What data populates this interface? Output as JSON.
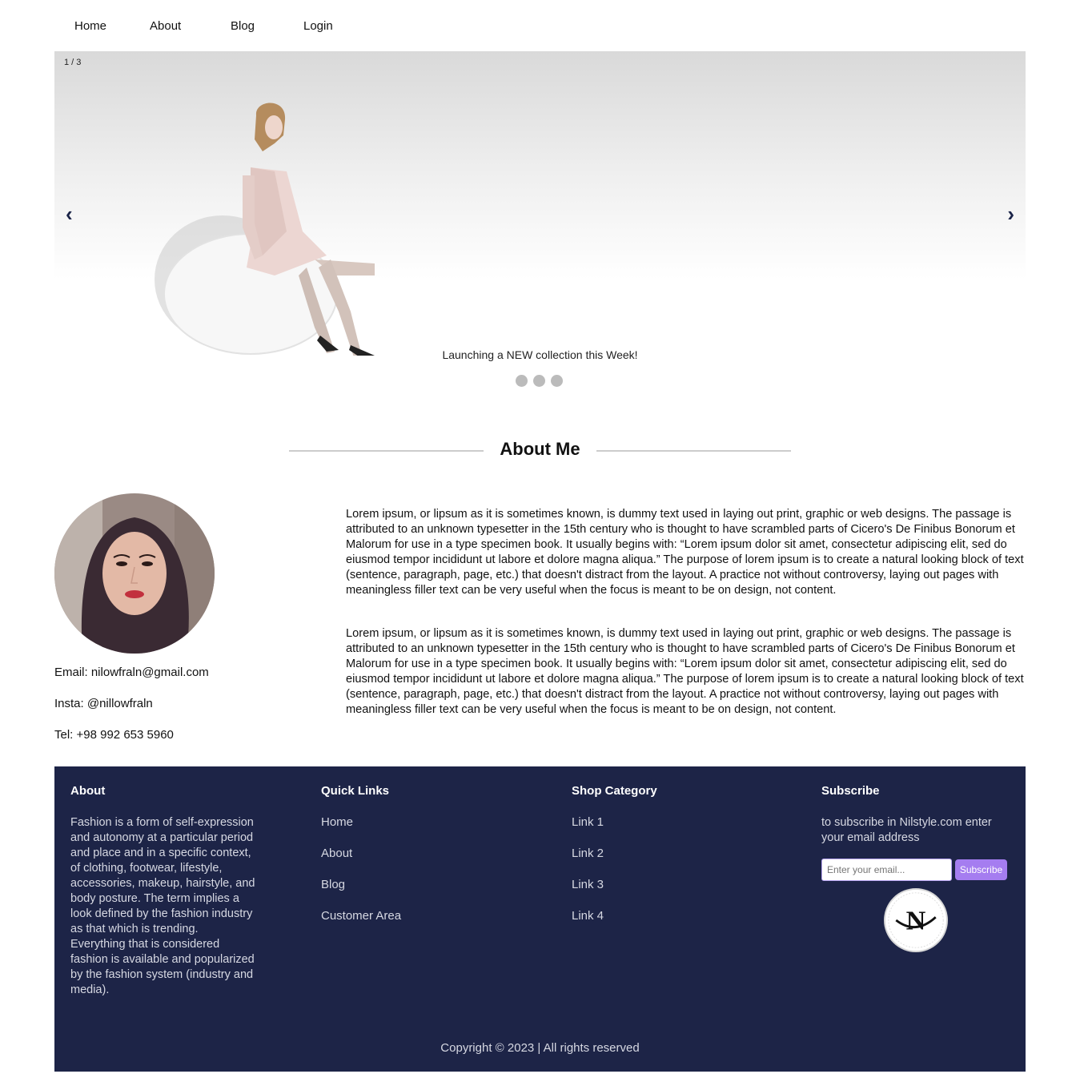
{
  "nav": {
    "items": [
      {
        "label": "Home"
      },
      {
        "label": "About"
      },
      {
        "label": "Blog"
      },
      {
        "label": "Login"
      }
    ]
  },
  "slider": {
    "counter": "1 / 3",
    "prev_icon": "chevron-left-icon",
    "next_icon": "chevron-right-icon",
    "prev_glyph": "‹",
    "next_glyph": "›",
    "caption": "Launching a NEW collection this Week!",
    "active_slide": 1,
    "slide_count": 3
  },
  "about": {
    "heading": "About Me",
    "email": "Email: nilowfraln@gmail.com",
    "insta": "Insta: @nillowfraln",
    "tel": "Tel: +98 992 653 5960",
    "paragraphs": [
      "Lorem ipsum, or lipsum as it is sometimes known, is dummy text used in laying out print, graphic or web designs. The passage is attributed to an unknown typesetter in the 15th century who is thought to have scrambled parts of Cicero's De Finibus Bonorum et Malorum for use in a type specimen book. It usually begins with: “Lorem ipsum dolor sit amet, consectetur adipiscing elit, sed do eiusmod tempor incididunt ut labore et dolore magna aliqua.” The purpose of lorem ipsum is to create a natural looking block of text (sentence, paragraph, page, etc.) that doesn't distract from the layout. A practice not without controversy, laying out pages with meaningless filler text can be very useful when the focus is meant to be on design, not content.",
      "Lorem ipsum, or lipsum as it is sometimes known, is dummy text used in laying out print, graphic or web designs. The passage is attributed to an unknown typesetter in the 15th century who is thought to have scrambled parts of Cicero's De Finibus Bonorum et Malorum for use in a type specimen book. It usually begins with: “Lorem ipsum dolor sit amet, consectetur adipiscing elit, sed do eiusmod tempor incididunt ut labore et dolore magna aliqua.” The purpose of lorem ipsum is to create a natural looking block of text (sentence, paragraph, page, etc.) that doesn't distract from the layout. A practice not without controversy, laying out pages with meaningless filler text can be very useful when the focus is meant to be on design, not content."
    ]
  },
  "footer": {
    "about_title": "About",
    "about_text": "Fashion is a form of self-expression and autonomy at a particular period and place and in a specific context, of clothing, footwear, lifestyle, accessories, makeup, hairstyle, and body posture. The term implies a look defined by the fashion industry as that which is trending. Everything that is considered fashion is available and popularized by the fashion system (industry and media).",
    "quick_title": "Quick Links",
    "quick_links": [
      "Home",
      "About",
      "Blog",
      "Customer Area"
    ],
    "shop_title": "Shop Category",
    "shop_links": [
      "Link 1",
      "Link 2",
      "Link 3",
      "Link 4"
    ],
    "subscribe_title": "Subscribe",
    "subscribe_text": "to subscribe in Nilstyle.com enter your email address",
    "email_placeholder": "Enter your email...",
    "subscribe_button": "Subscribe",
    "logo_text": "N",
    "copyright": "Copyright © 2023 | All rights reserved"
  },
  "colors": {
    "footer_bg": "#1d2447",
    "accent": "#a57df0",
    "arrow": "#1b2448"
  }
}
